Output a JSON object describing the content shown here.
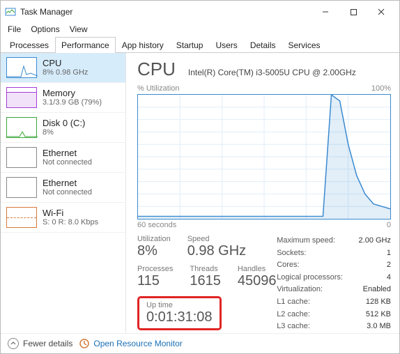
{
  "window": {
    "title": "Task Manager"
  },
  "menu": {
    "file": "File",
    "options": "Options",
    "view": "View"
  },
  "tabs": {
    "processes": "Processes",
    "performance": "Performance",
    "apphistory": "App history",
    "startup": "Startup",
    "users": "Users",
    "details": "Details",
    "services": "Services"
  },
  "sidebar": {
    "cpu": {
      "title": "CPU",
      "sub": "8%  0.98 GHz"
    },
    "mem": {
      "title": "Memory",
      "sub": "3.1/3.9 GB (79%)"
    },
    "disk": {
      "title": "Disk 0 (C:)",
      "sub": "8%"
    },
    "eth1": {
      "title": "Ethernet",
      "sub": "Not connected"
    },
    "eth2": {
      "title": "Ethernet",
      "sub": "Not connected"
    },
    "wifi": {
      "title": "Wi-Fi",
      "sub": "S: 0  R: 8.0 Kbps"
    }
  },
  "main": {
    "title": "CPU",
    "model": "Intel(R) Core(TM) i3-5005U CPU @ 2.00GHz",
    "chart_top_left": "% Utilization",
    "chart_top_right": "100%",
    "chart_bottom_left": "60 seconds",
    "chart_bottom_right": "0",
    "stat_util_label": "Utilization",
    "stat_util_val": "8%",
    "stat_speed_label": "Speed",
    "stat_speed_val": "0.98 GHz",
    "stat_proc_label": "Processes",
    "stat_proc_val": "115",
    "stat_thr_label": "Threads",
    "stat_thr_val": "1615",
    "stat_hnd_label": "Handles",
    "stat_hnd_val": "45096",
    "uptime_label": "Up time",
    "uptime_val": "0:01:31:08",
    "right": [
      {
        "lab": "Maximum speed:",
        "val": "2.00 GHz"
      },
      {
        "lab": "Sockets:",
        "val": "1"
      },
      {
        "lab": "Cores:",
        "val": "2"
      },
      {
        "lab": "Logical processors:",
        "val": "4"
      },
      {
        "lab": "Virtualization:",
        "val": "Enabled"
      },
      {
        "lab": "L1 cache:",
        "val": "128 KB"
      },
      {
        "lab": "L2 cache:",
        "val": "512 KB"
      },
      {
        "lab": "L3 cache:",
        "val": "3.0 MB"
      }
    ]
  },
  "footer": {
    "fewer": "Fewer details",
    "orm": "Open Resource Monitor"
  },
  "chart_data": {
    "type": "line",
    "title": "CPU % Utilization",
    "xlabel": "seconds ago",
    "ylabel": "% Utilization",
    "ylim": [
      0,
      100
    ],
    "x": [
      60,
      58,
      56,
      54,
      52,
      50,
      48,
      46,
      44,
      42,
      40,
      38,
      36,
      34,
      32,
      30,
      28,
      26,
      24,
      22,
      20,
      18,
      16,
      14,
      12,
      10,
      8,
      6,
      4,
      2,
      0
    ],
    "values": [
      2,
      2,
      2,
      2,
      2,
      2,
      2,
      2,
      2,
      2,
      2,
      2,
      2,
      2,
      2,
      2,
      2,
      2,
      2,
      2,
      2,
      2,
      2,
      100,
      95,
      60,
      35,
      20,
      12,
      10,
      8
    ]
  }
}
